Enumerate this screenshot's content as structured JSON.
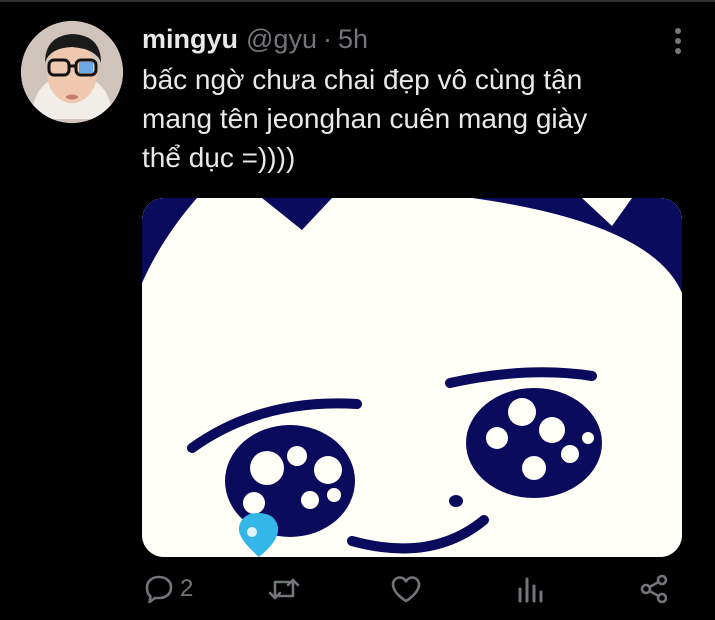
{
  "tweet": {
    "author": {
      "display_name": "mingyu",
      "handle": "@gyu",
      "avatar_icon": "user-avatar"
    },
    "separator": "·",
    "time": "5h",
    "text": "bấc ngờ chưa chai đẹp vô cùng tận\nmang tên jeonghan cuên mang giày\nthể dục =))))",
    "media": {
      "type": "image",
      "description": "cartoon-crying-face"
    },
    "actions": {
      "reply_icon": "reply-icon",
      "reply_count": "2",
      "retweet_icon": "retweet-icon",
      "like_icon": "heart-icon",
      "analytics_icon": "analytics-icon",
      "share_icon": "share-icon"
    }
  },
  "colors": {
    "background": "#000000",
    "text_primary": "#e7e9ea",
    "text_secondary": "#71767b",
    "divider": "#2f3336",
    "cartoon_ink": "#0b0b5e",
    "cartoon_tear": "#35b6e8"
  }
}
